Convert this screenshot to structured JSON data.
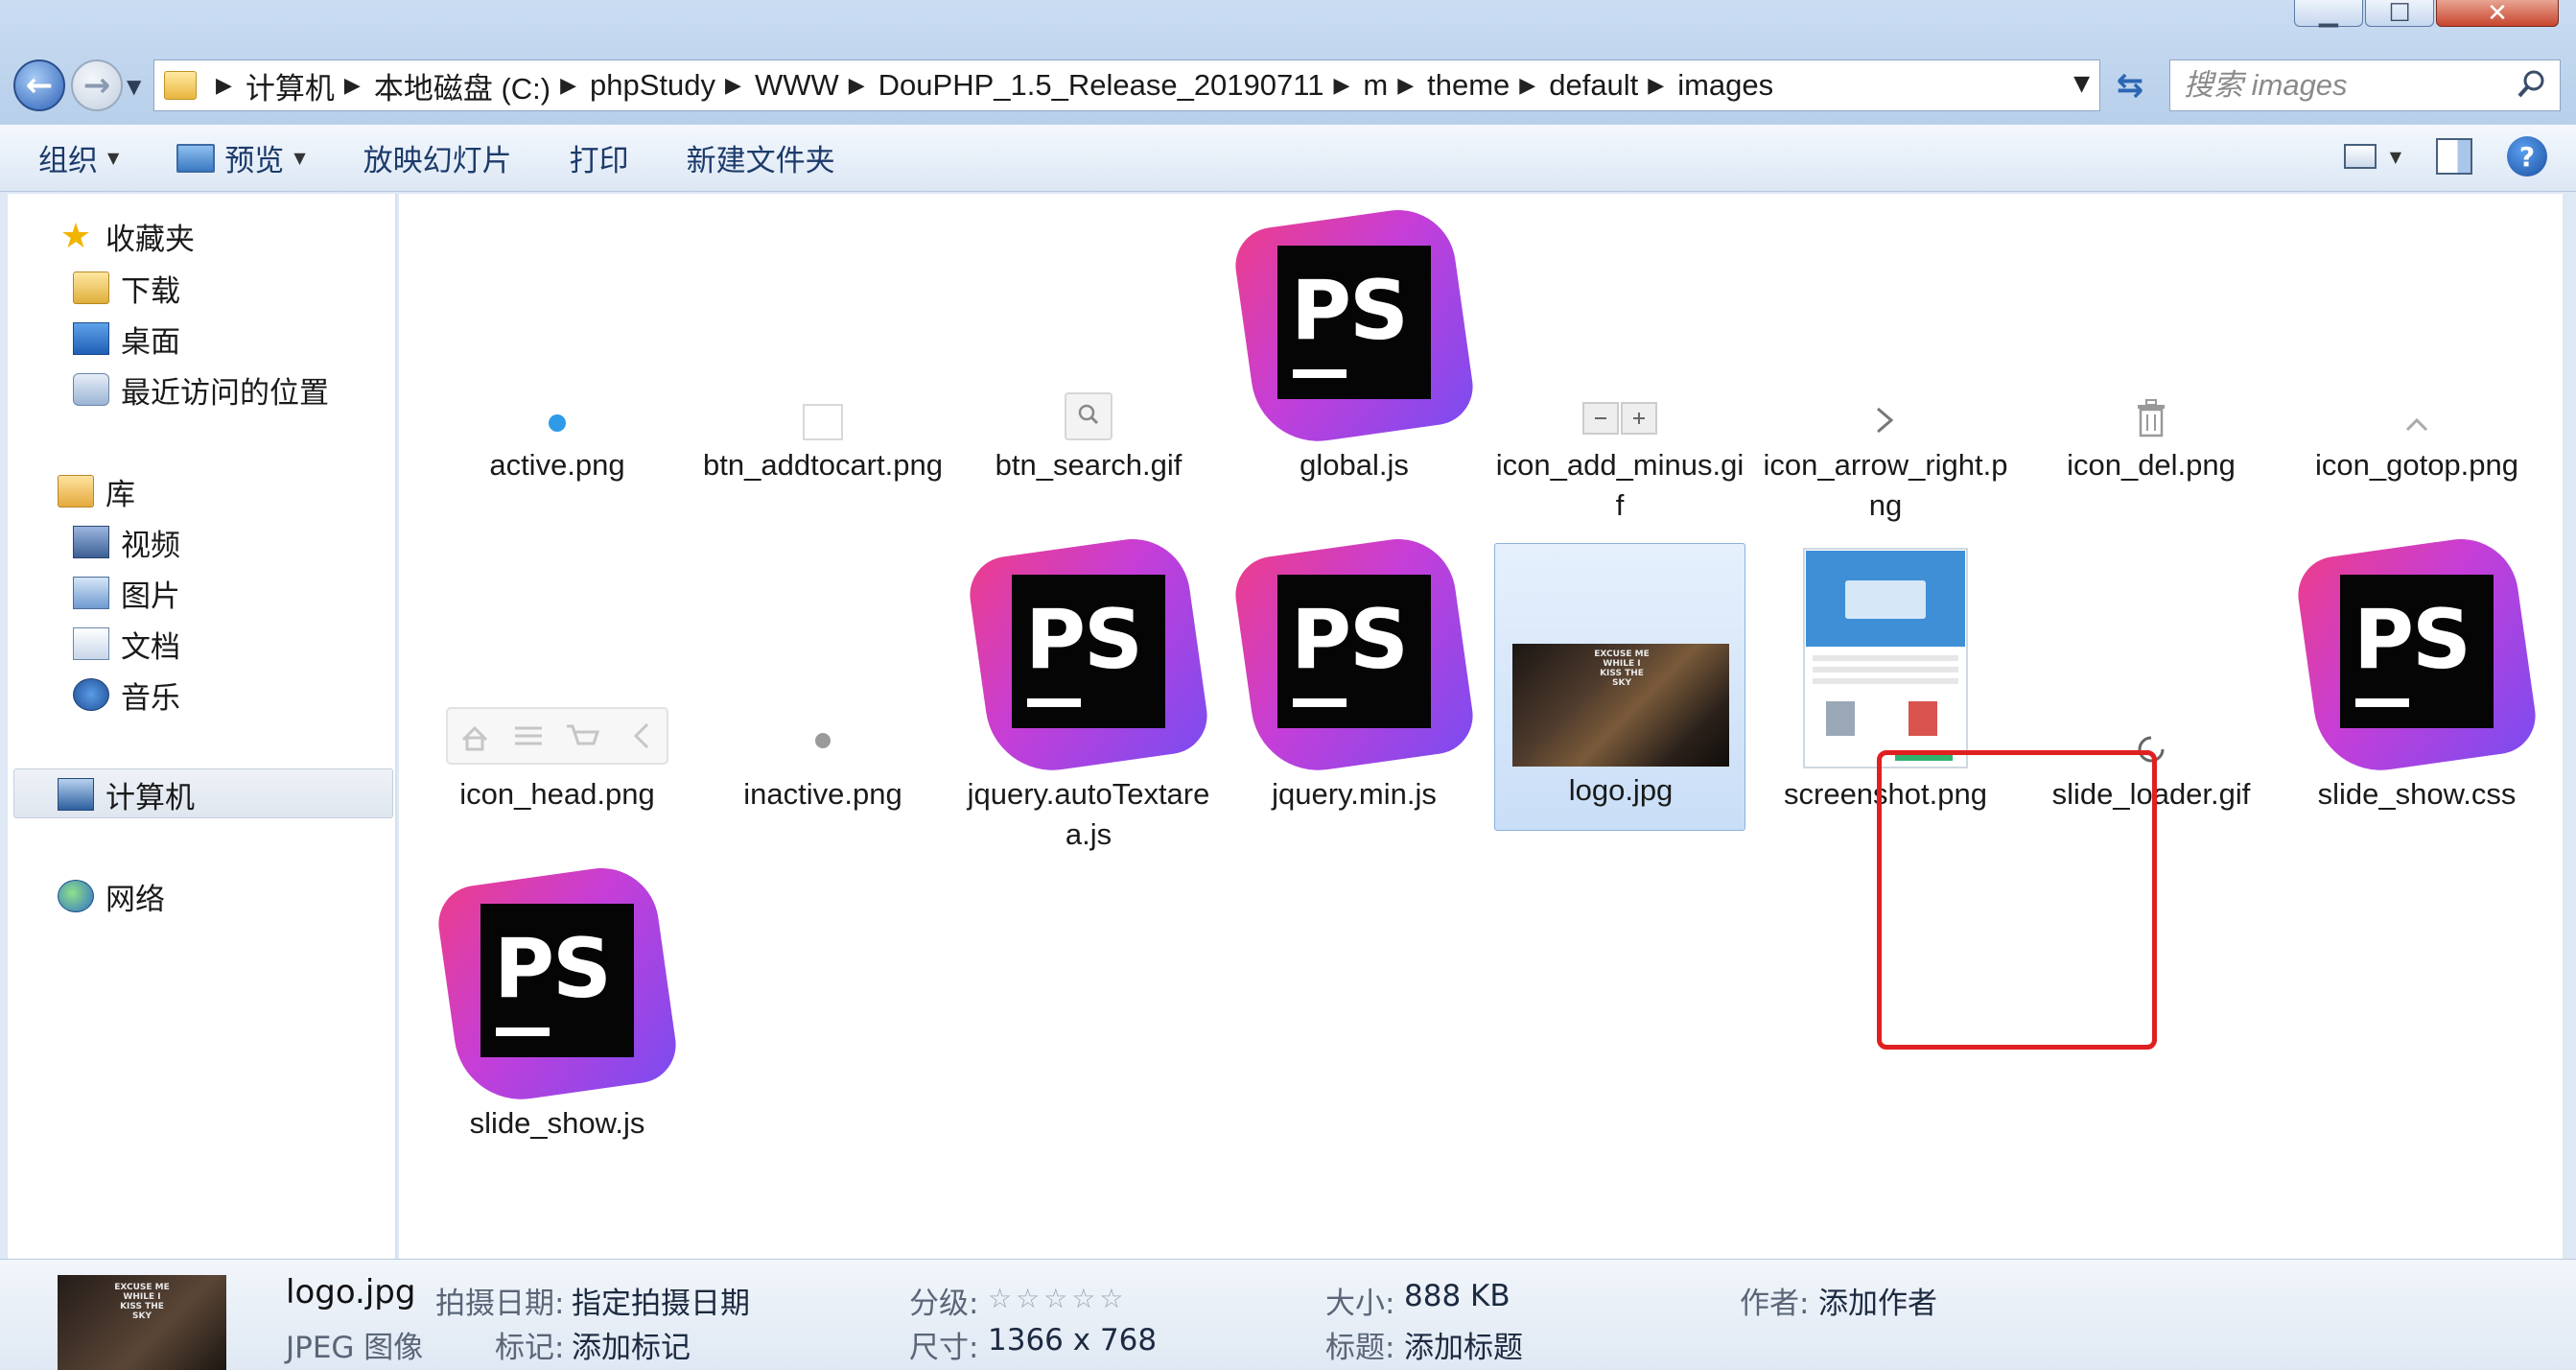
{
  "address": {
    "crumbs": [
      "计算机",
      "本地磁盘 (C:)",
      "phpStudy",
      "WWW",
      "DouPHP_1.5_Release_20190711",
      "m",
      "theme",
      "default",
      "images"
    ],
    "search_placeholder": "搜索 images"
  },
  "toolbar": {
    "organize": "组织",
    "preview": "预览",
    "slideshow": "放映幻灯片",
    "print": "打印",
    "new_folder": "新建文件夹"
  },
  "nav": {
    "favorites": "收藏夹",
    "downloads": "下载",
    "desktop": "桌面",
    "recent": "最近访问的位置",
    "libraries": "库",
    "videos": "视频",
    "pictures": "图片",
    "documents": "文档",
    "music": "音乐",
    "computer": "计算机",
    "network": "网络"
  },
  "files": [
    {
      "name": "active.png",
      "kind": "dot"
    },
    {
      "name": "btn_addtocart.png",
      "kind": "blank"
    },
    {
      "name": "btn_search.gif",
      "kind": "search"
    },
    {
      "name": "global.js",
      "kind": "ps"
    },
    {
      "name": "icon_add_minus.gif",
      "kind": "addminus"
    },
    {
      "name": "icon_arrow_right.png",
      "kind": "arrow"
    },
    {
      "name": "icon_del.png",
      "kind": "trash"
    },
    {
      "name": "icon_gotop.png",
      "kind": "gotop"
    },
    {
      "name": "icon_head.png",
      "kind": "head"
    },
    {
      "name": "inactive.png",
      "kind": "graydot"
    },
    {
      "name": "jquery.autoTextarea.js",
      "kind": "ps"
    },
    {
      "name": "jquery.min.js",
      "kind": "ps"
    },
    {
      "name": "logo.jpg",
      "kind": "photo",
      "selected": true
    },
    {
      "name": "screenshot.png",
      "kind": "screenshot"
    },
    {
      "name": "slide_loader.gif",
      "kind": "loader"
    },
    {
      "name": "slide_show.css",
      "kind": "ps"
    },
    {
      "name": "slide_show.js",
      "kind": "ps"
    }
  ],
  "photo_caption": "EXCUSE ME WHILE I KISS THE SKY",
  "details": {
    "name": "logo.jpg",
    "type": "JPEG 图像",
    "date_label": "拍摄日期:",
    "date_value": "指定拍摄日期",
    "tags_label": "标记:",
    "tags_value": "添加标记",
    "rating_label": "分级:",
    "rating_value": 0,
    "dimensions_label": "尺寸:",
    "dimensions_value": "1366 x 768",
    "size_label": "大小:",
    "size_value": "888 KB",
    "title_label": "标题:",
    "title_value": "添加标题",
    "author_label": "作者:",
    "author_value": "添加作者"
  },
  "colors": {
    "selection": "#cce0f8",
    "highlight_box": "#e02020",
    "ps_gradient_start": "#ec3d8c",
    "ps_gradient_end": "#7b4cf0"
  }
}
